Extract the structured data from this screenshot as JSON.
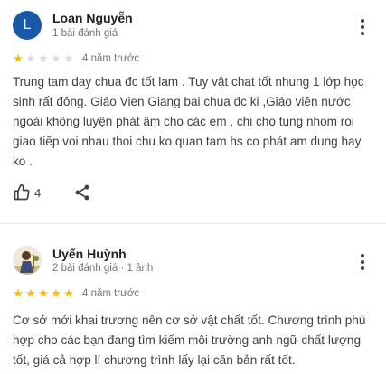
{
  "reviews": [
    {
      "avatar_letter": "L",
      "avatar_color": "#1a58a8",
      "name": "Loan Nguyễn",
      "meta": "1 bài đánh giá",
      "rating": 1,
      "date": "4 năm trước",
      "text": "Trung tam day chua đc tốt lam . Tuy vật chat tốt nhung 1 lớp học sinh rất đông. Giáo Vien Giang bai chua đc ki ,Giáo viên nước ngoài không luyện phát âm cho các em , chi cho tung nhom roi giao tiếp voi nhau thoi chu ko quan tam hs co phát am dung hay ko .",
      "likes": "4",
      "icons": {
        "like": "thumbs-up-icon",
        "share": "share-icon",
        "more": "more-vert-icon"
      }
    },
    {
      "name": "Uyển Huỳnh",
      "meta": "2 bài đánh giá · 1 ảnh",
      "rating": 5,
      "date": "4 năm trước",
      "text": "Cơ sở mới khai trương nên cơ sở vật chất tốt. Chương trình phù hợp cho các bạn đang tìm kiếm môi trường anh ngữ chất lượng tốt, giá cả hợp lí chương trình lấy lại căn bản rất tốt.",
      "icons": {
        "more": "more-vert-icon",
        "avatar": "profile-photo"
      }
    }
  ],
  "colors": {
    "star_on": "#fbbc04",
    "star_off": "#dadce0",
    "meta": "#70757a",
    "text": "#3c4043"
  }
}
